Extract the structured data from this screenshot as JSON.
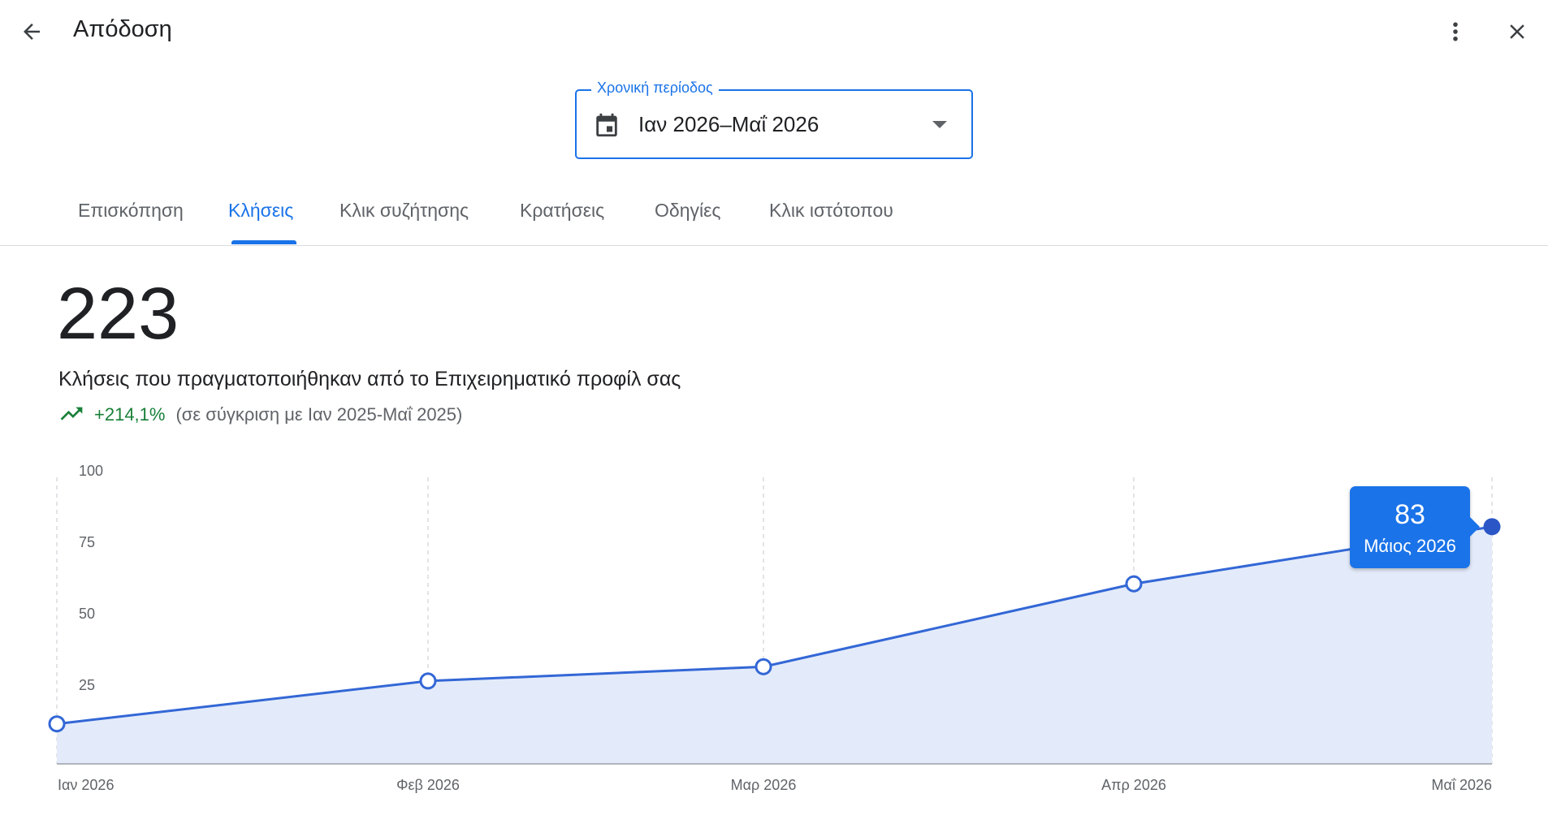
{
  "header": {
    "title": "Απόδοση",
    "back_icon": "arrow-back-icon",
    "more_icon": "more-vert-icon",
    "close_icon": "close-icon"
  },
  "period": {
    "label": "Χρονική περίοδος",
    "value": "Ιαν 2026–Μαΐ 2026",
    "icon": "calendar-icon"
  },
  "tabs": [
    {
      "label": "Επισκόπηση",
      "active": false
    },
    {
      "label": "Κλήσεις",
      "active": true
    },
    {
      "label": "Κλικ συζήτησης",
      "active": false
    },
    {
      "label": "Κρατήσεις",
      "active": false
    },
    {
      "label": "Οδηγίες",
      "active": false
    },
    {
      "label": "Κλικ ιστότοπου",
      "active": false
    }
  ],
  "summary": {
    "total": "223",
    "description": "Κλήσεις που πραγματοποιήθηκαν από το Επιχειρηματικό προφίλ σας",
    "change": "+214,1%",
    "comparison": "(σε σύγκριση με Ιαν 2025-Μαΐ 2025)"
  },
  "colors": {
    "accent": "#1a73e8",
    "line": "#3367d6",
    "area_fill": "#e3ebfa",
    "positive": "#188038",
    "selected_point": "#2a56c6"
  },
  "chart_data": {
    "type": "area",
    "categories": [
      "Ιαν 2026",
      "Φεβ 2026",
      "Μαρ 2026",
      "Απρ 2026",
      "Μαΐ 2026"
    ],
    "values": [
      14,
      29,
      34,
      63,
      83
    ],
    "y_ticks": [
      "25",
      "50",
      "75",
      "100"
    ],
    "ylim": [
      0,
      100
    ],
    "grid": "vertical",
    "selected": {
      "value": "83",
      "label": "Μάιος 2026"
    }
  }
}
